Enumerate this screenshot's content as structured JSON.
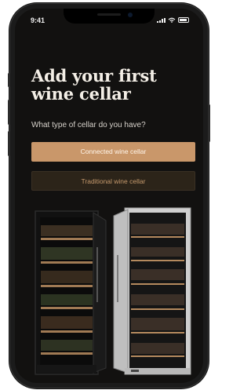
{
  "status_bar": {
    "time": "9:41"
  },
  "onboarding": {
    "title": "Add your first\nwine cellar",
    "subtitle": "What type of cellar do you have?",
    "primary_button": "Connected wine cellar",
    "secondary_button": "Traditional wine cellar"
  },
  "illustration": {
    "name": "two-wine-cellars-image"
  },
  "colors": {
    "accent": "#c9976a",
    "background": "#121110",
    "secondary_button_bg": "#2c2419"
  }
}
